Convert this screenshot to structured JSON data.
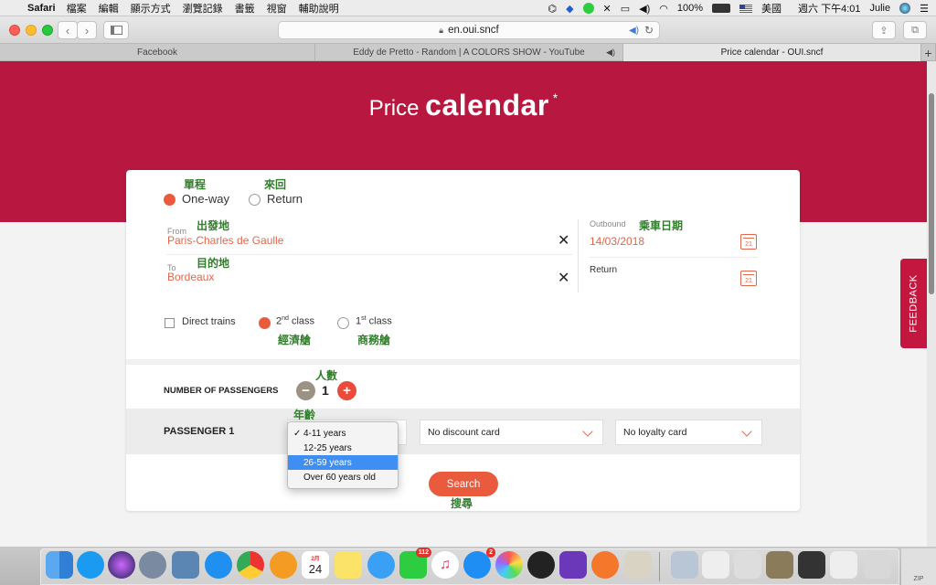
{
  "menubar": {
    "app": "Safari",
    "items": [
      "檔案",
      "編輯",
      "顯示方式",
      "瀏覽記錄",
      "書籤",
      "視窗",
      "輔助說明"
    ],
    "battery": "100%",
    "input_source": "美國",
    "clock": "週六 下午4:01",
    "user": "Julie"
  },
  "browser": {
    "url": "en.oui.sncf",
    "tabs": [
      {
        "label": "Facebook"
      },
      {
        "label": "Eddy de Pretto - Random | A COLORS SHOW - YouTube"
      },
      {
        "label": "Price calendar - OUI.sncf"
      }
    ],
    "new_tab": "+"
  },
  "page": {
    "title_light": "Price",
    "title_bold": "calendar",
    "title_star": "*",
    "trip_type": {
      "one_way": "One-way",
      "return": "Return",
      "one_way_ann": "單程",
      "return_ann": "來回",
      "selected": "one_way"
    },
    "from": {
      "label": "From",
      "value": "Paris-Charles de Gaulle",
      "ann": "出發地"
    },
    "to": {
      "label": "To",
      "value": "Bordeaux",
      "ann": "目的地"
    },
    "outbound": {
      "label": "Outbound",
      "value": "14/03/2018",
      "ann": "乘車日期",
      "cal_day": "21"
    },
    "return_date": {
      "label": "Return",
      "cal_day": "21"
    },
    "options": {
      "direct": "Direct trains",
      "second_class": "2nd class",
      "second_sup": "nd",
      "second_base": "2",
      "second_ann": "經濟艙",
      "first_base": "1",
      "first_sup": "st",
      "first_text": " class",
      "first_ann": "商務艙",
      "selected_class": "second"
    },
    "passengers": {
      "label": "NUMBER OF PASSENGERS",
      "count": "1",
      "ann": "人數",
      "minus": "−",
      "plus": "+"
    },
    "passenger1": {
      "label": "PASSENGER 1",
      "age_ann": "年齡",
      "discount": "No discount card",
      "loyalty": "No loyalty card"
    },
    "age_options": [
      {
        "label": "4-11 years",
        "checked": true
      },
      {
        "label": "12-25 years"
      },
      {
        "label": "26-59 years",
        "highlighted": true
      },
      {
        "label": "Over 60 years old"
      }
    ],
    "search": {
      "label": "Search",
      "ann": "搜尋"
    },
    "feedback": "FEEDBACK"
  },
  "dock": {
    "calendar_month": "2月",
    "calendar_day": "24",
    "line_badge": "112",
    "appstore_badge": "2",
    "zip_label": "ZIP"
  },
  "colors": {
    "brand": "#b8173f",
    "accent": "#ea5a3d",
    "annotation": "#2f7f2a"
  }
}
